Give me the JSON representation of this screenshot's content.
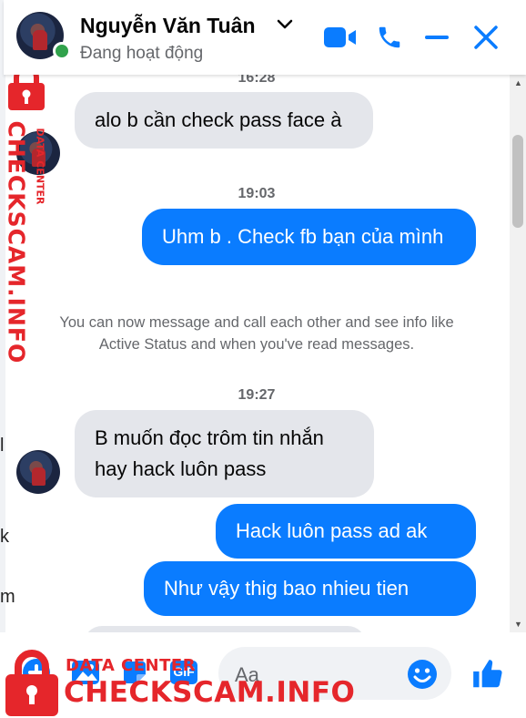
{
  "header": {
    "contact_name": "Nguyễn Văn Tuân",
    "status": "Đang hoạt động"
  },
  "messages": {
    "time_1": "16:28",
    "msg_1": "alo b cần check pass face à",
    "time_2": "19:03",
    "msg_2": "Uhm b . Check fb bạn của mình",
    "system_notice": "You can now message and call each other and see info like Active Status and when you've read messages.",
    "time_3": "19:27",
    "msg_3": "B muốn đọc trôm tin nhắn hay hack luôn pass",
    "msg_4": "Hack luôn pass ad ak",
    "msg_5": "Như vậy thig bao nhieu tien"
  },
  "composer": {
    "placeholder": "Aa",
    "gif_label": "GIF"
  },
  "watermark": {
    "line_1": "DATA CENTER",
    "line_2": "CHECKSCAM.INFO"
  },
  "behind_page_chars": [
    "l",
    "k",
    "m"
  ],
  "colors": {
    "accent": "#0a7cff",
    "incoming_bubble": "#e4e6eb",
    "online": "#31a24c",
    "watermark": "#e5262b"
  },
  "icons": [
    "chevron-down-icon",
    "video-call-icon",
    "phone-icon",
    "minimize-icon",
    "close-icon",
    "plus-icon",
    "image-icon",
    "sticker-icon",
    "gif-icon",
    "emoji-icon",
    "thumbs-up-icon"
  ]
}
